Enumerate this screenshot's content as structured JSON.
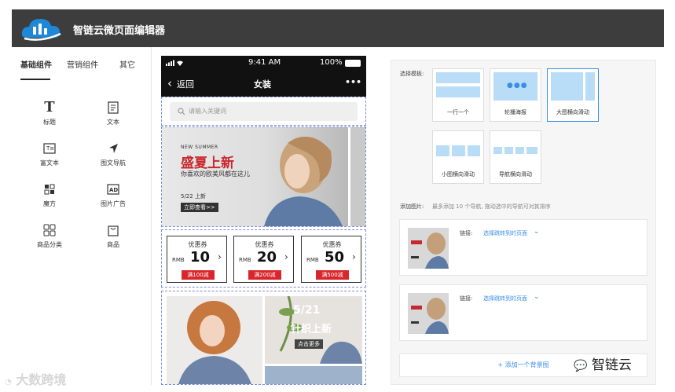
{
  "app": {
    "title": "智链云微页面编辑器"
  },
  "left_tabs": [
    {
      "label": "基础组件"
    },
    {
      "label": "营销组件"
    },
    {
      "label": "其它"
    }
  ],
  "widgets": [
    {
      "label": "标题",
      "icon": "title-icon"
    },
    {
      "label": "文本",
      "icon": "text-icon"
    },
    {
      "label": "富文本",
      "icon": "rich-text-icon"
    },
    {
      "label": "图文导航",
      "icon": "nav-arrow-icon"
    },
    {
      "label": "魔方",
      "icon": "cube-icon"
    },
    {
      "label": "图片广告",
      "icon": "ad-icon"
    },
    {
      "label": "商品分类",
      "icon": "grid-icon"
    },
    {
      "label": "商品",
      "icon": "bag-icon"
    }
  ],
  "phone": {
    "status_time": "9:41 AM",
    "battery": "100%",
    "back_label": "返回",
    "nav_title": "女装",
    "more": "•••",
    "search_placeholder": "请输入关键词",
    "banner": {
      "eyebrow": "NEW SUMMER",
      "headline": "盛夏上新",
      "subline": "你喜欢的欧美风都在这儿",
      "date": "5/22 上新",
      "cta": "立即查看>>"
    },
    "coupons": [
      {
        "title": "优惠券",
        "currency": "RMB",
        "amount": "10",
        "condition": "满100减"
      },
      {
        "title": "优惠券",
        "currency": "RMB",
        "amount": "20",
        "condition": "满200减"
      },
      {
        "title": "优惠券",
        "currency": "RMB",
        "amount": "50",
        "condition": "满500减"
      }
    ],
    "promo": {
      "date": "5/21",
      "title": "针织上新",
      "cta": "点击更多"
    }
  },
  "panel": {
    "template_label": "选择模板:",
    "templates": [
      {
        "label": "一行一个",
        "selected": false
      },
      {
        "label": "轮播海报",
        "selected": false
      },
      {
        "label": "大图横向滑动",
        "selected": true
      },
      {
        "label": "小图横向滑动",
        "selected": false
      },
      {
        "label": "导航横向滑动",
        "selected": false
      }
    ],
    "add_image_label": "添加图片:",
    "add_image_hint": "最多添加 10 个导航, 拖动选中的导航可对其排序",
    "link_label": "链接:",
    "link_placeholder": "选择跳转到的页面",
    "add_background": "+ 添加一个背景图"
  },
  "watermarks": {
    "left": "大数跨境",
    "right": "智链云"
  },
  "colors": {
    "topbar": "#3d3d3d",
    "accent_blue": "#3a8ee6",
    "coupon_red": "#d9262c",
    "template_fill": "#b9dcf7"
  }
}
